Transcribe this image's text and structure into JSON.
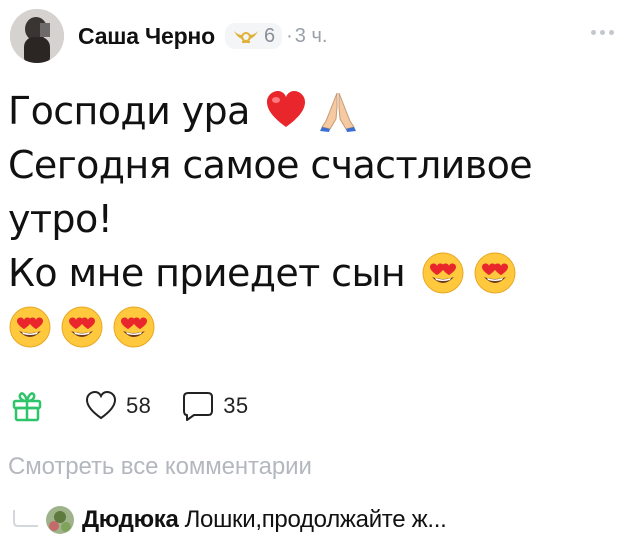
{
  "post": {
    "author": "Саша Черно",
    "badge_level": "6",
    "separator": "·",
    "time": "3 ч.",
    "text_lines": [
      "Господи ура",
      "Сегодня самое счастливое",
      "утро!",
      "Ко мне приедет сын"
    ],
    "likes_count": "58",
    "comments_count": "35",
    "view_all_comments": "Смотреть все комментарии"
  },
  "comment_preview": {
    "author": "Дюдюка",
    "text": "Лошки,продолжайте ж..."
  },
  "icons": {
    "more": "more-dots-icon",
    "badge": "wings-badge-icon",
    "heart_emoji": "red-heart-emoji",
    "pray_emoji": "folded-hands-emoji",
    "heart_eyes_emoji": "heart-eyes-emoji",
    "gift": "gift-icon",
    "like": "heart-outline-icon",
    "comment": "comment-bubble-icon"
  },
  "colors": {
    "accent_green": "#2ec46a",
    "badge_gold": "#e0b23a",
    "muted_text": "#9aa0a8",
    "faint_text": "#b4b8be",
    "heart_red": "#e8262c",
    "emoji_yellow": "#ffc83d"
  }
}
